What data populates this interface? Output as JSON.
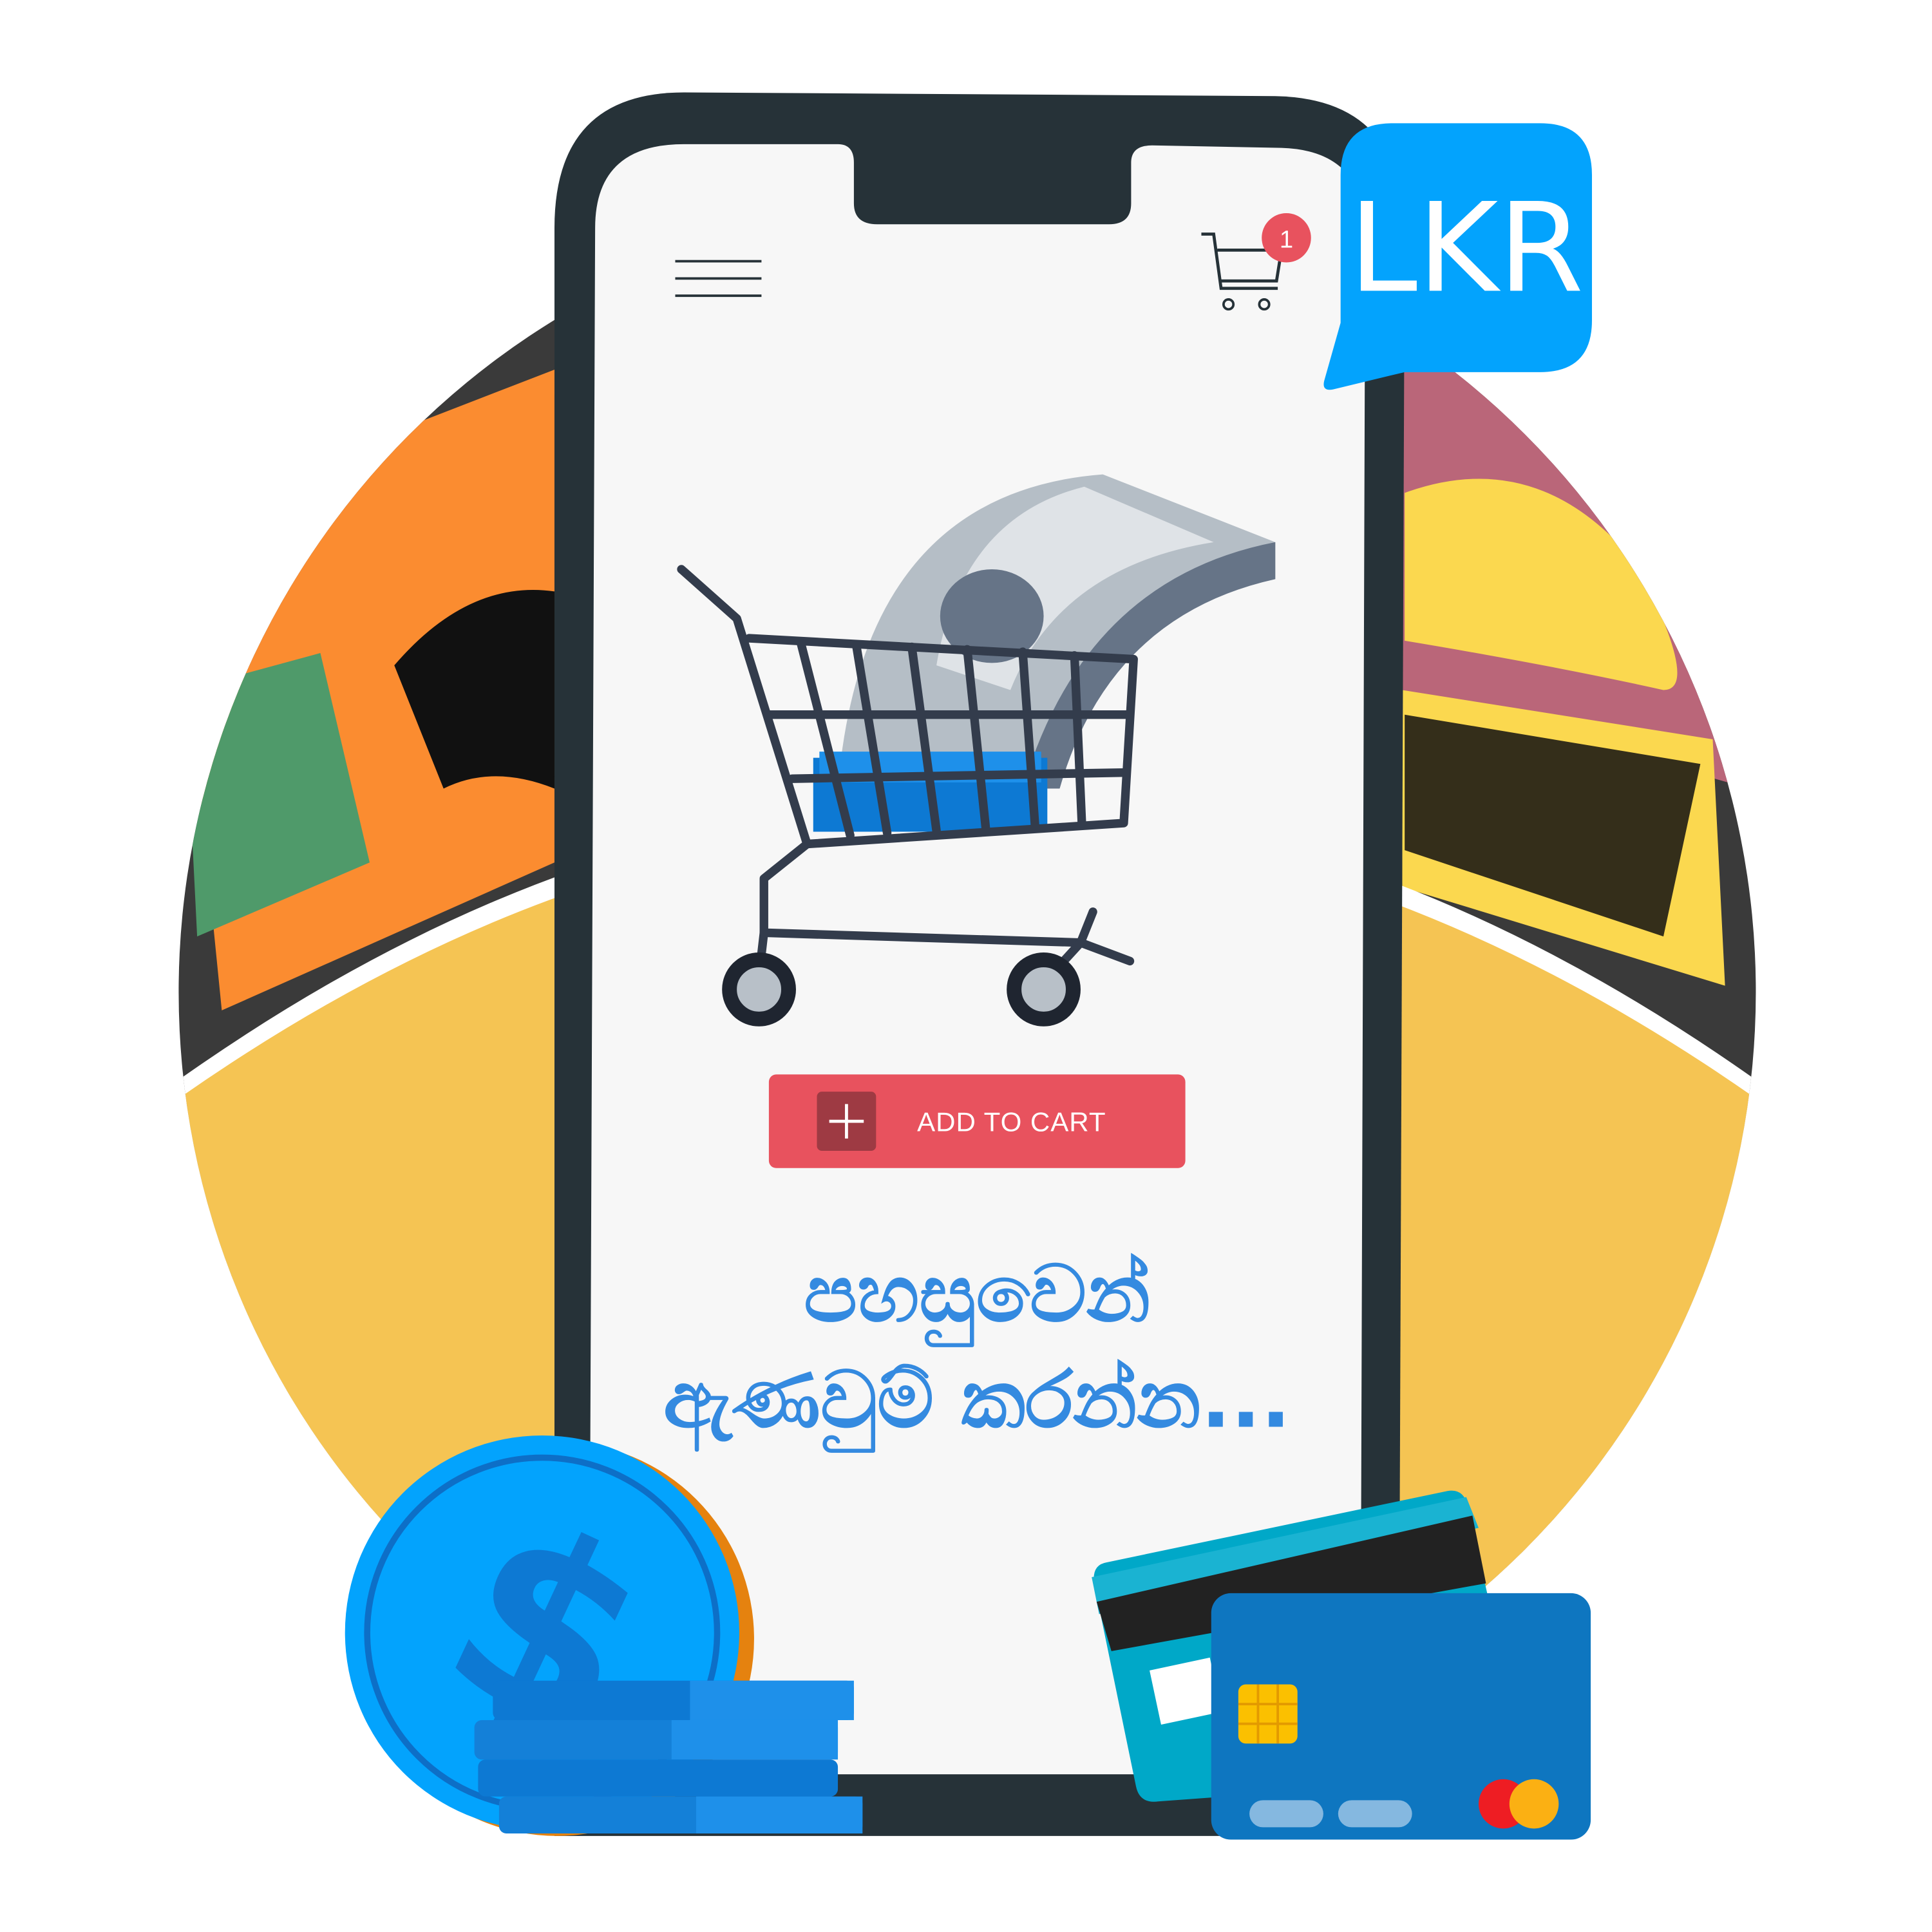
{
  "header": {
    "menu_icon": "hamburger-menu-icon",
    "cart_icon": "shopping-cart-icon",
    "cart_count": "1"
  },
  "currency_badge": {
    "label": "LKR",
    "color": "#03a3fd"
  },
  "product": {
    "illustration": "shopping-cart-with-money-icon"
  },
  "add_to_cart": {
    "label": "ADD TO CART",
    "icon": "plus-icon",
    "color": "#e8525e"
  },
  "tagline": {
    "line1": "පහසුවෙන්",
    "line2": "ඇණවුම් කරන්න..."
  },
  "colors": {
    "text_accent": "#348ae0",
    "phone_frame": "#263238",
    "background_circle": "#f5c453"
  }
}
